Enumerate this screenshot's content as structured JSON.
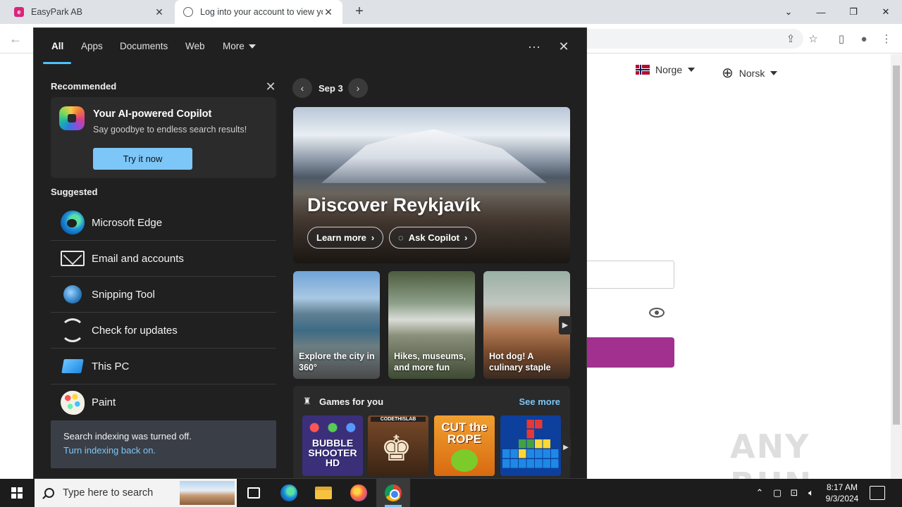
{
  "browser": {
    "tabs": [
      {
        "title": "EasyPark AB",
        "favicon": "easypark-icon",
        "active": false
      },
      {
        "title": "Log into your account to view yo",
        "favicon": "globe-icon",
        "active": true
      }
    ],
    "new_tab": "+",
    "window_controls": {
      "dropdown": "⌄",
      "minimize": "—",
      "restore": "❐",
      "close": "✕"
    }
  },
  "page": {
    "country": "Norge",
    "language": "Norsk",
    "accent_color": "#a2308f"
  },
  "watermark": "ANY RUN",
  "search_panel": {
    "tabs": [
      "All",
      "Apps",
      "Documents",
      "Web",
      "More"
    ],
    "active_tab": "All",
    "more_options": "···",
    "close": "✕",
    "recommended_label": "Recommended",
    "copilot": {
      "title": "Your AI-powered Copilot",
      "subtitle": "Say goodbye to endless search results!",
      "button": "Try it now"
    },
    "suggested_label": "Suggested",
    "suggested": [
      {
        "label": "Microsoft Edge",
        "icon": "edge-icon"
      },
      {
        "label": "Email and accounts",
        "icon": "mail-icon"
      },
      {
        "label": "Snipping Tool",
        "icon": "snipping-tool-icon"
      },
      {
        "label": "Check for updates",
        "icon": "refresh-icon"
      },
      {
        "label": "This PC",
        "icon": "computer-icon"
      },
      {
        "label": "Paint",
        "icon": "paint-palette-icon"
      }
    ],
    "indexing": {
      "message": "Search indexing was turned off.",
      "link": "Turn indexing back on."
    },
    "date": "Sep 3",
    "hero": {
      "title": "Discover Reykjavík",
      "learn_more": "Learn more",
      "ask_copilot": "Ask Copilot"
    },
    "cards": [
      {
        "text": "Explore the city in 360°"
      },
      {
        "text": "Hikes, museums, and more fun"
      },
      {
        "text": "Hot dog! A culinary staple"
      }
    ],
    "games": {
      "title": "Games for you",
      "see_more": "See more",
      "items": [
        {
          "name": "BUBBLE SHOOTER HD"
        },
        {
          "name": "CODETHISLAB"
        },
        {
          "name": "CUT the ROPE"
        },
        {
          "name": "Tetris blocks"
        }
      ]
    }
  },
  "taskbar": {
    "search_placeholder": "Type here to search",
    "time": "8:17 AM",
    "date": "9/3/2024"
  }
}
